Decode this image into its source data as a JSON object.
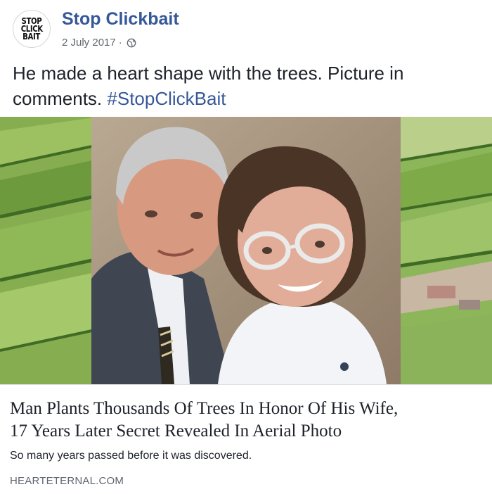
{
  "post": {
    "avatar": {
      "lines": [
        "STOP",
        "CLICK",
        "BAIT"
      ]
    },
    "page_name": "Stop Clickbait",
    "date": "2 July 2017",
    "separator": "·",
    "privacy_icon": "globe-icon",
    "text": "He made a heart shape with the trees. Picture in comments.",
    "hashtag": "#StopClickBait",
    "link_preview": {
      "title_line1": "Man Plants Thousands Of Trees In Honor Of His Wife,",
      "title_line2": "17 Years Later Secret Revealed In Aerial Photo",
      "description": "So many years passed before it was discovered.",
      "domain": "HEARTETERNAL.COM"
    }
  },
  "colors": {
    "link_blue": "#365899",
    "meta_gray": "#616770",
    "field_green": "#7fa84a"
  }
}
